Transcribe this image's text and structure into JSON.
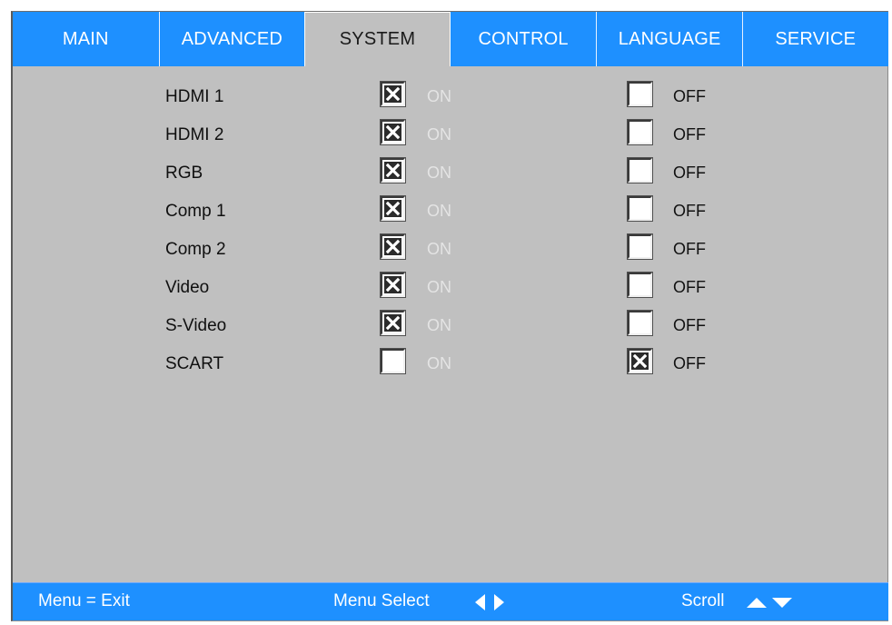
{
  "tabs": [
    {
      "label": "MAIN",
      "active": false
    },
    {
      "label": "ADVANCED",
      "active": false
    },
    {
      "label": "SYSTEM",
      "active": true
    },
    {
      "label": "CONTROL",
      "active": false
    },
    {
      "label": "LANGUAGE",
      "active": false
    },
    {
      "label": "SERVICE",
      "active": false
    }
  ],
  "options": {
    "on_label": "ON",
    "off_label": "OFF"
  },
  "sources": [
    {
      "label": "HDMI 1",
      "on": true
    },
    {
      "label": "HDMI 2",
      "on": true
    },
    {
      "label": "RGB",
      "on": true
    },
    {
      "label": "Comp 1",
      "on": true
    },
    {
      "label": "Comp 2",
      "on": true
    },
    {
      "label": "Video",
      "on": true
    },
    {
      "label": "S-Video",
      "on": true
    },
    {
      "label": "SCART",
      "on": false
    }
  ],
  "footer": {
    "exit": "Menu = Exit",
    "select": "Menu Select",
    "scroll": "Scroll",
    "select_icon": "left-right-arrows-icon",
    "scroll_icon": "up-down-arrows-icon"
  },
  "colors": {
    "accent": "#1e90ff",
    "panel": "#c0c0c0",
    "on_text": "#e4e4e4",
    "off_text": "#111111"
  }
}
